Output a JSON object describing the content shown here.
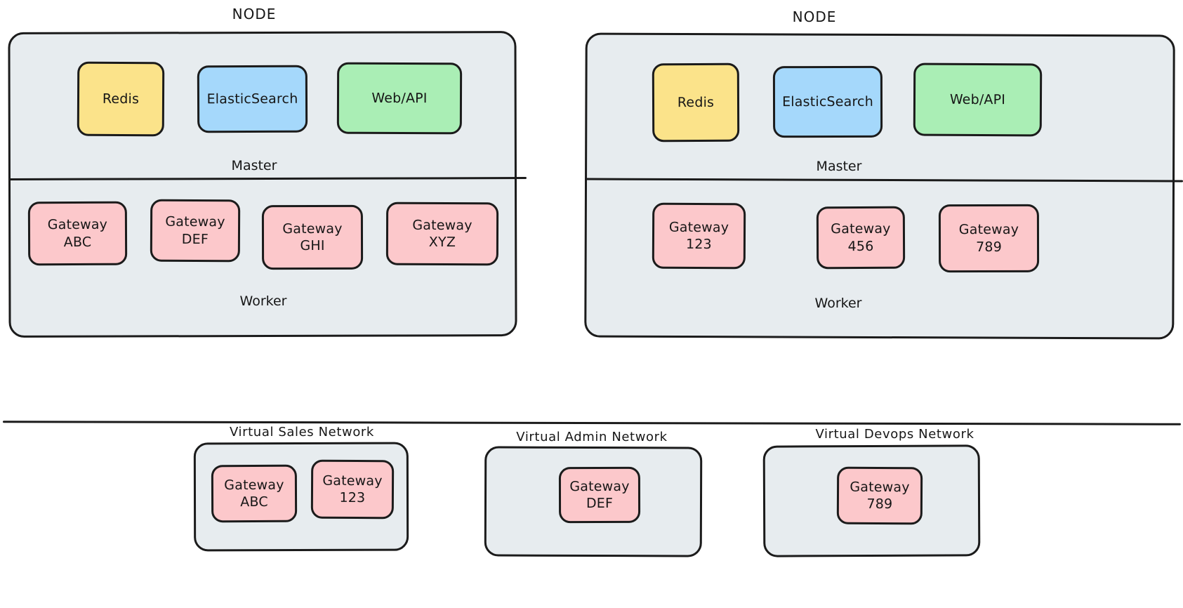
{
  "diagram": {
    "title_style": "hand-drawn architecture diagram",
    "colors": {
      "panel_background": "#e7ecef",
      "redis": "#fbe38a",
      "elasticsearch": "#a5d8fb",
      "webapi": "#aaeeb5",
      "gateway": "#fcc8cb",
      "stroke": "#1b1b1b",
      "page_background": "#ffffff"
    }
  },
  "nodes": [
    {
      "caption": "NODE",
      "master": {
        "caption": "Master",
        "services": [
          {
            "label": "Redis",
            "color_key": "redis"
          },
          {
            "label": "ElasticSearch",
            "color_key": "elasticsearch"
          },
          {
            "label": "Web/API",
            "color_key": "webapi"
          }
        ]
      },
      "worker": {
        "caption": "Worker",
        "gateways": [
          {
            "line1": "Gateway",
            "line2": "ABC"
          },
          {
            "line1": "Gateway",
            "line2": "DEF"
          },
          {
            "line1": "Gateway",
            "line2": "GHI"
          },
          {
            "line1": "Gateway",
            "line2": "XYZ"
          }
        ]
      }
    },
    {
      "caption": "NODE",
      "master": {
        "caption": "Master",
        "services": [
          {
            "label": "Redis",
            "color_key": "redis"
          },
          {
            "label": "ElasticSearch",
            "color_key": "elasticsearch"
          },
          {
            "label": "Web/API",
            "color_key": "webapi"
          }
        ]
      },
      "worker": {
        "caption": "Worker",
        "gateways": [
          {
            "line1": "Gateway",
            "line2": "123"
          },
          {
            "line1": "Gateway",
            "line2": "456"
          },
          {
            "line1": "Gateway",
            "line2": "789"
          }
        ]
      }
    }
  ],
  "virtual_networks": [
    {
      "caption": "Virtual Sales Network",
      "gateways": [
        {
          "line1": "Gateway",
          "line2": "ABC"
        },
        {
          "line1": "Gateway",
          "line2": "123"
        }
      ]
    },
    {
      "caption": "Virtual Admin Network",
      "gateways": [
        {
          "line1": "Gateway",
          "line2": "DEF"
        }
      ]
    },
    {
      "caption": "Virtual Devops Network",
      "gateways": [
        {
          "line1": "Gateway",
          "line2": "789"
        }
      ]
    }
  ]
}
